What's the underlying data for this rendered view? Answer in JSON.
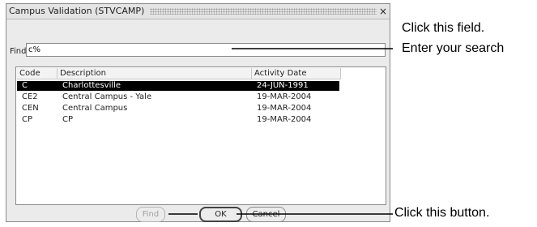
{
  "dialog": {
    "title": "Campus Validation (STVCAMP)",
    "close_glyph": "×"
  },
  "find": {
    "label": "Find",
    "value": "c%"
  },
  "table": {
    "headers": [
      "Code",
      "Description",
      "Activity Date"
    ],
    "rows": [
      {
        "code": "C",
        "description": "Charlottesville",
        "date": "24-JUN-1991",
        "selected": true
      },
      {
        "code": "CE2",
        "description": "Central Campus - Yale",
        "date": "19-MAR-2004",
        "selected": false
      },
      {
        "code": "CEN",
        "description": "Central Campus",
        "date": "19-MAR-2004",
        "selected": false
      },
      {
        "code": "CP",
        "description": "CP",
        "date": "19-MAR-2004",
        "selected": false
      }
    ]
  },
  "buttons": {
    "find": "Find",
    "ok": "OK",
    "cancel": "Cancel"
  },
  "annotations": {
    "line1": "Click this field.",
    "line2": "Enter your search",
    "line3": "Click this button."
  }
}
